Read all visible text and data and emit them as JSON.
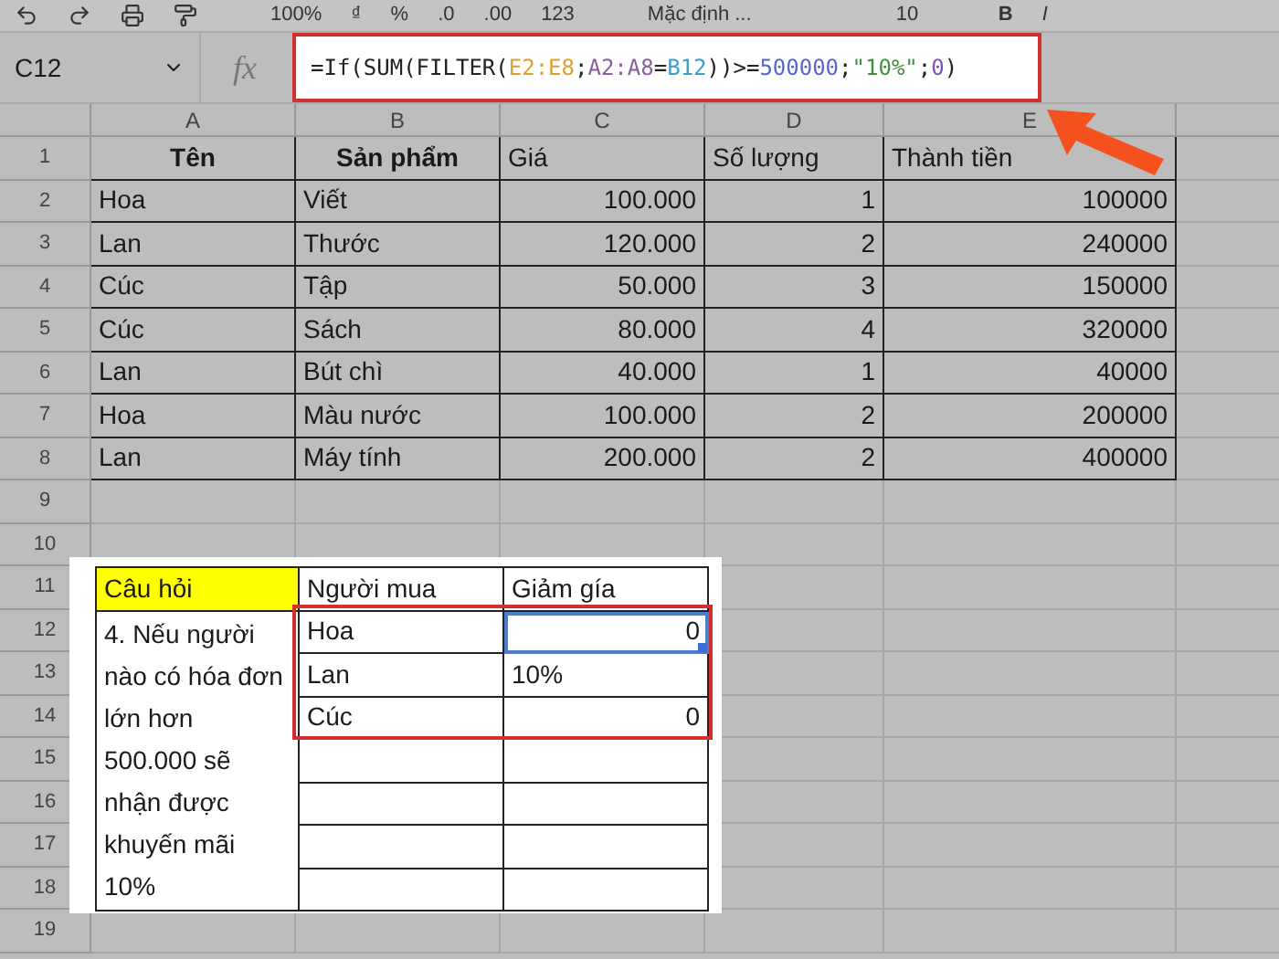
{
  "toolbar": {
    "zoom": "100%",
    "items": [
      "₫",
      "%",
      ".0",
      ".00",
      "123"
    ],
    "font": "Mặc định ...",
    "font_size": "10",
    "bold": "B",
    "italic": "I"
  },
  "name_box": "C12",
  "fx": "fx",
  "formula": [
    {
      "text": "=If(SUM(FILTER(",
      "color": "#222222"
    },
    {
      "text": "E2:E8",
      "color": "#e0a030"
    },
    {
      "text": ";",
      "color": "#222222"
    },
    {
      "text": "A2:A8",
      "color": "#8e5ea2"
    },
    {
      "text": "=",
      "color": "#222222"
    },
    {
      "text": "B12",
      "color": "#3aa0c8"
    },
    {
      "text": "))>=",
      "color": "#222222"
    },
    {
      "text": "500000",
      "color": "#5566cc"
    },
    {
      "text": ";",
      "color": "#222222"
    },
    {
      "text": "\"10%\"",
      "color": "#3f8f3f"
    },
    {
      "text": ";",
      "color": "#222222"
    },
    {
      "text": "0",
      "color": "#7b4fbf"
    },
    {
      "text": ")",
      "color": "#222222"
    }
  ],
  "columns": [
    "A",
    "B",
    "C",
    "D",
    "E"
  ],
  "row_numbers": [
    "1",
    "2",
    "3",
    "4",
    "5",
    "6",
    "7",
    "8",
    "9",
    "10",
    "11",
    "12",
    "13",
    "14",
    "15",
    "16",
    "17",
    "18",
    "19"
  ],
  "table": {
    "header": [
      {
        "text": "Tên",
        "bold": true
      },
      {
        "text": "Sản phẩm",
        "bold": true
      },
      {
        "text": "Giá",
        "bold": false
      },
      {
        "text": "Số lượng",
        "bold": false
      },
      {
        "text": "Thành tiền",
        "bold": false
      }
    ],
    "rows": [
      [
        "Hoa",
        "Viết",
        "100.000",
        "1",
        "100000"
      ],
      [
        "Lan",
        "Thước",
        "120.000",
        "2",
        "240000"
      ],
      [
        "Cúc",
        "Tập",
        "50.000",
        "3",
        "150000"
      ],
      [
        "Cúc",
        "Sách",
        "80.000",
        "4",
        "320000"
      ],
      [
        "Lan",
        "Bút chì",
        "40.000",
        "1",
        "40000"
      ],
      [
        "Hoa",
        "Màu nước",
        "100.000",
        "2",
        "200000"
      ],
      [
        "Lan",
        "Máy tính",
        "200.000",
        "2",
        "400000"
      ]
    ]
  },
  "panel": {
    "question_label": "Câu hỏi",
    "question": "4. Nếu người nào có hóa đơn lớn hơn 500.000 sẽ nhận được khuyến mãi 10%",
    "headers": [
      "Người mua",
      "Giảm gía"
    ],
    "rows": [
      {
        "buyer": "Hoa",
        "discount": "0",
        "kind": "number",
        "selected": true
      },
      {
        "buyer": "Lan",
        "discount": "10%",
        "kind": "text",
        "selected": false
      },
      {
        "buyer": "Cúc",
        "discount": "0",
        "kind": "number",
        "selected": false
      }
    ]
  }
}
